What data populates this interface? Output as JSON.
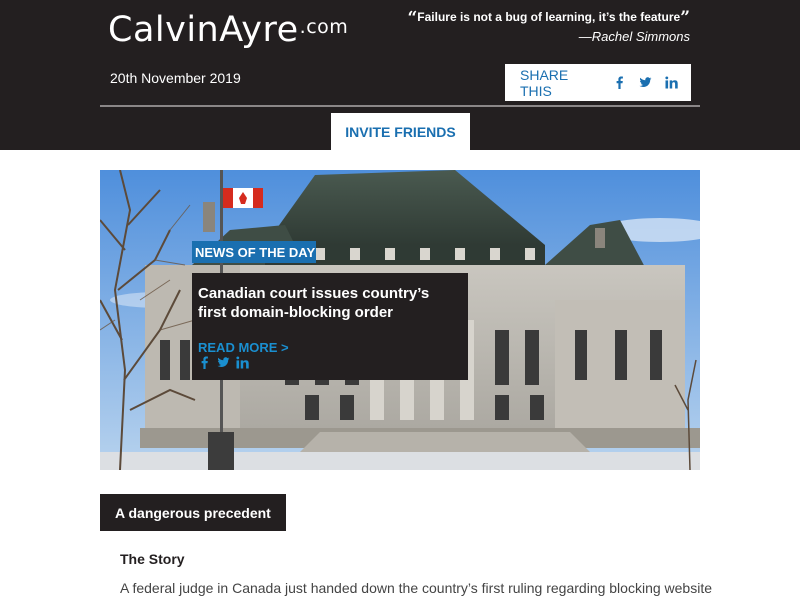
{
  "header": {
    "logo_main": "CalvinAyre",
    "logo_suffix": ".com",
    "quote_text": "Failure is not a bug of learning, it’s the feature",
    "quote_author": "—Rachel Simmons",
    "date": "20th November 2019",
    "share_label": "SHARE THIS",
    "invite_label": "INVITE FRIENDS"
  },
  "hero": {
    "tag": "NEWS OF THE DAY",
    "headline": "Canadian court issues country’s first domain-blocking order",
    "read_more": "READ MORE >"
  },
  "article": {
    "section_title": "A dangerous precedent",
    "story_label": "The Story",
    "story_text": "A federal judge in Canada just handed down the country’s first ruling regarding blocking website"
  },
  "icons": {
    "quote_open": "“",
    "quote_close": "”",
    "facebook": "facebook-icon",
    "twitter": "twitter-icon",
    "linkedin": "linkedin-icon"
  },
  "colors": {
    "header_bg": "#231f20",
    "accent_blue": "#1a6fb0",
    "white": "#ffffff"
  }
}
